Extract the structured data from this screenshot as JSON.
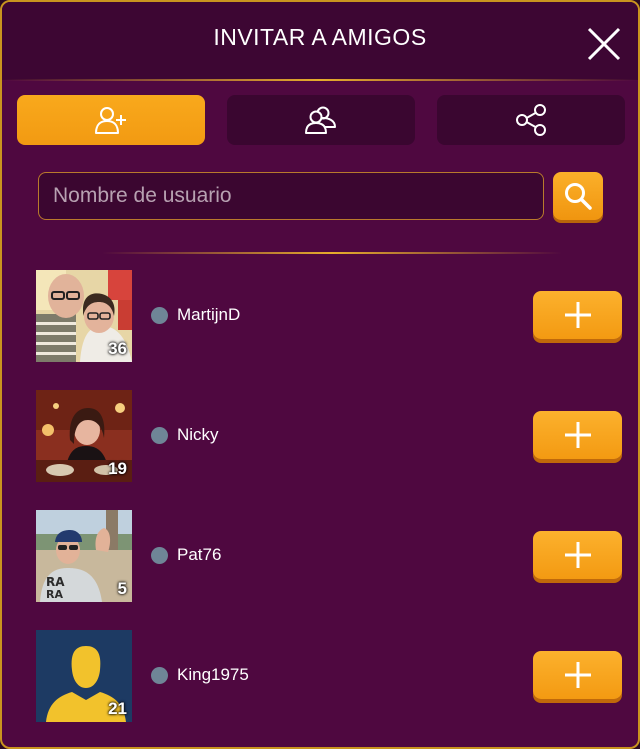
{
  "header": {
    "title": "INVITAR A AMIGOS"
  },
  "tabs": [
    {
      "icon": "add-user-icon",
      "active": true
    },
    {
      "icon": "friends-icon",
      "active": false
    },
    {
      "icon": "share-icon",
      "active": false
    }
  ],
  "search": {
    "placeholder": "Nombre de usuario",
    "value": ""
  },
  "users": [
    {
      "name": "MartijnD",
      "level": "36",
      "status": "offline"
    },
    {
      "name": "Nicky",
      "level": "19",
      "status": "offline"
    },
    {
      "name": "Pat76",
      "level": "5",
      "status": "offline"
    },
    {
      "name": "King1975",
      "level": "21",
      "status": "offline"
    }
  ],
  "colors": {
    "background": "#4f0840",
    "header": "#3d0633",
    "accent": "#f5a116",
    "border": "#c9941f",
    "status_offline": "#6f8597"
  }
}
